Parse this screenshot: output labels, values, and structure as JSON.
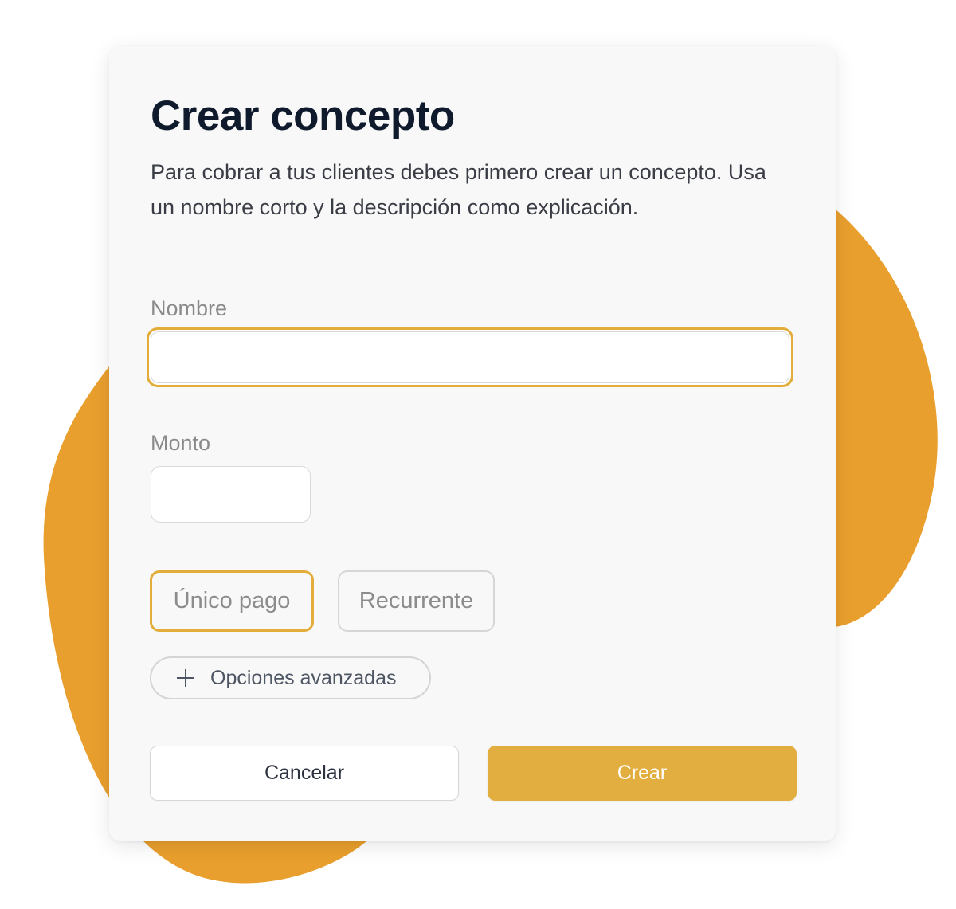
{
  "colors": {
    "accent": "#E3AE40",
    "blob": "#E99F2D",
    "title": "#0F1B2D",
    "card": "#F8F8F8"
  },
  "dialog": {
    "title": "Crear concepto",
    "description": "Para cobrar a tus clientes debes primero crear un concepto. Usa un nombre corto y la descripción como explicación."
  },
  "form": {
    "name_label": "Nombre",
    "name_value": "",
    "amount_label": "Monto",
    "amount_value": ""
  },
  "payment_type": {
    "options": [
      "Único pago",
      "Recurrente"
    ],
    "selected": "Único pago"
  },
  "advanced": {
    "label": "Opciones avanzadas",
    "icon": "plus-icon"
  },
  "actions": {
    "cancel_label": "Cancelar",
    "create_label": "Crear"
  }
}
